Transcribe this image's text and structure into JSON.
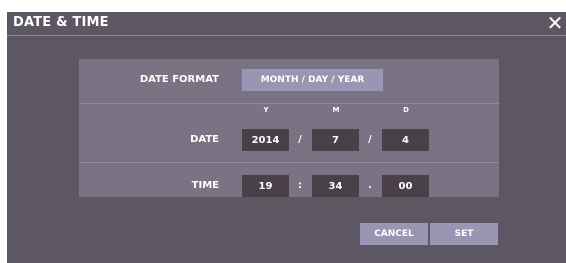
{
  "dialog": {
    "title": "DATE & TIME",
    "close_glyph": "✕",
    "close_icon": "close-icon"
  },
  "date_format": {
    "label": "DATE FORMAT",
    "value": "MONTH / DAY / YEAR"
  },
  "date": {
    "label": "DATE",
    "year_header": "Y",
    "month_header": "M",
    "day_header": "D",
    "year": "2014",
    "month": "7",
    "day": "4",
    "separator": "/"
  },
  "time": {
    "label": "TIME",
    "hour": "19",
    "minute": "34",
    "second": "00",
    "separator_hm": ":",
    "separator_ms": "."
  },
  "buttons": {
    "cancel": "CANCEL",
    "set": "SET"
  },
  "colors": {
    "dialog_bg": "#5d5763",
    "panel_bg": "#7a7384",
    "button_bg": "#9b95b4",
    "field_bg": "#4a4047"
  }
}
